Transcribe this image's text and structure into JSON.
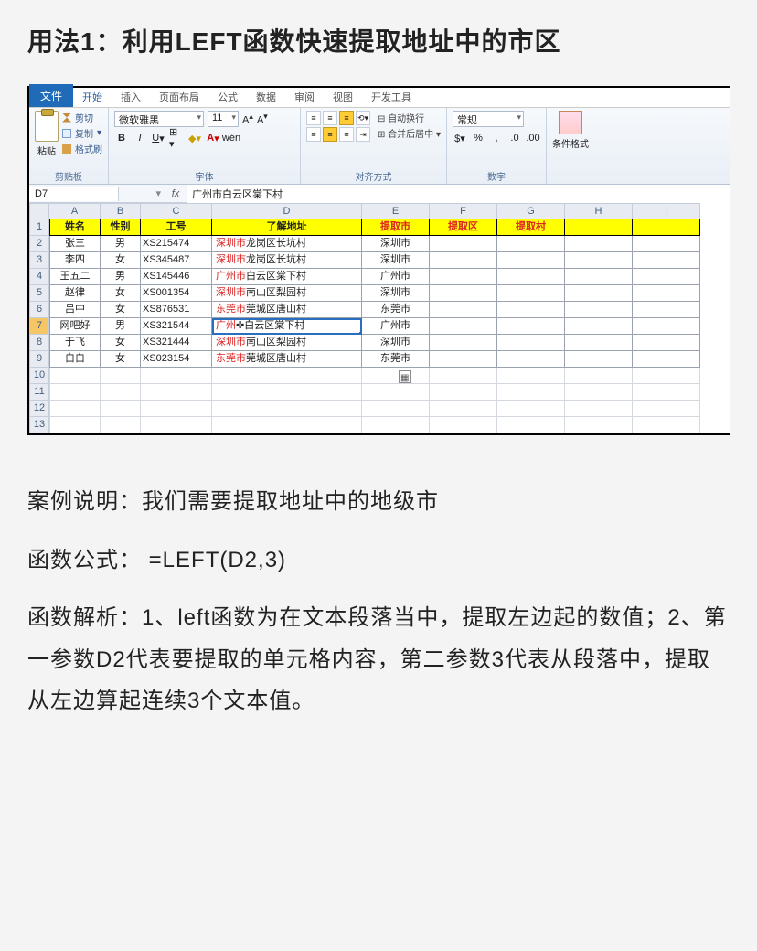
{
  "heading": "用法1：利用LEFT函数快速提取地址中的市区",
  "ribbon": {
    "tabs": {
      "file": "文件",
      "home": "开始",
      "insert": "插入",
      "layout": "页面布局",
      "formula": "公式",
      "data": "数据",
      "review": "审阅",
      "view": "视图",
      "dev": "开发工具"
    },
    "paste_label": "粘贴",
    "cut": "剪切",
    "copy": "复制",
    "fmtpaint": "格式刷",
    "grp_clipboard": "剪贴板",
    "font_name": "微软雅黑",
    "font_size": "11",
    "grp_font": "字体",
    "wrap": "自动换行",
    "merge": "合并后居中",
    "grp_align": "对齐方式",
    "numfmt": "常规",
    "grp_number": "数字",
    "condfmt": "条件格式"
  },
  "fbar": {
    "name": "D7",
    "formula": "广州市白云区棠下村"
  },
  "cols": [
    "A",
    "B",
    "C",
    "D",
    "E",
    "F",
    "G",
    "H",
    "I"
  ],
  "header_row": {
    "A": "姓名",
    "B": "性别",
    "C": "工号",
    "D": "了解地址",
    "E": "提取市",
    "F": "提取区",
    "G": "提取村"
  },
  "rows": [
    {
      "n": "2",
      "A": "张三",
      "B": "男",
      "C": "XS215474",
      "Dp": "深圳市",
      "Ds": "龙岗区长坑村",
      "E": "深圳市"
    },
    {
      "n": "3",
      "A": "李四",
      "B": "女",
      "C": "XS345487",
      "Dp": "深圳市",
      "Ds": "龙岗区长坑村",
      "E": "深圳市"
    },
    {
      "n": "4",
      "A": "王五二",
      "B": "男",
      "C": "XS145446",
      "Dp": "广州市",
      "Ds": "白云区棠下村",
      "E": "广州市"
    },
    {
      "n": "5",
      "A": "赵律",
      "B": "女",
      "C": "XS001354",
      "Dp": "深圳市",
      "Ds": "南山区梨园村",
      "E": "深圳市"
    },
    {
      "n": "6",
      "A": "吕中",
      "B": "女",
      "C": "XS876531",
      "Dp": "东莞市",
      "Ds": "莞城区唐山村",
      "E": "东莞市"
    },
    {
      "n": "7",
      "A": "网吧好",
      "B": "男",
      "C": "XS321544",
      "Dp": "广州",
      "Dmid": "✜",
      "Ds": "白云区棠下村",
      "E": "广州市",
      "selected": true
    },
    {
      "n": "8",
      "A": "于飞",
      "B": "女",
      "C": "XS321444",
      "Dp": "深圳市",
      "Ds": "南山区梨园村",
      "E": "深圳市"
    },
    {
      "n": "9",
      "A": "白白",
      "B": "女",
      "C": "XS023154",
      "Dp": "东莞市",
      "Ds": "莞城区唐山村",
      "E": "东莞市"
    }
  ],
  "empty_rows": [
    "10",
    "11",
    "12",
    "13"
  ],
  "para1": "案例说明：我们需要提取地址中的地级市",
  "para2": "函数公式： =LEFT(D2,3)",
  "para3": "函数解析：1、left函数为在文本段落当中，提取左边起的数值；2、第一参数D2代表要提取的单元格内容，第二参数3代表从段落中，提取从左边算起连续3个文本值。"
}
